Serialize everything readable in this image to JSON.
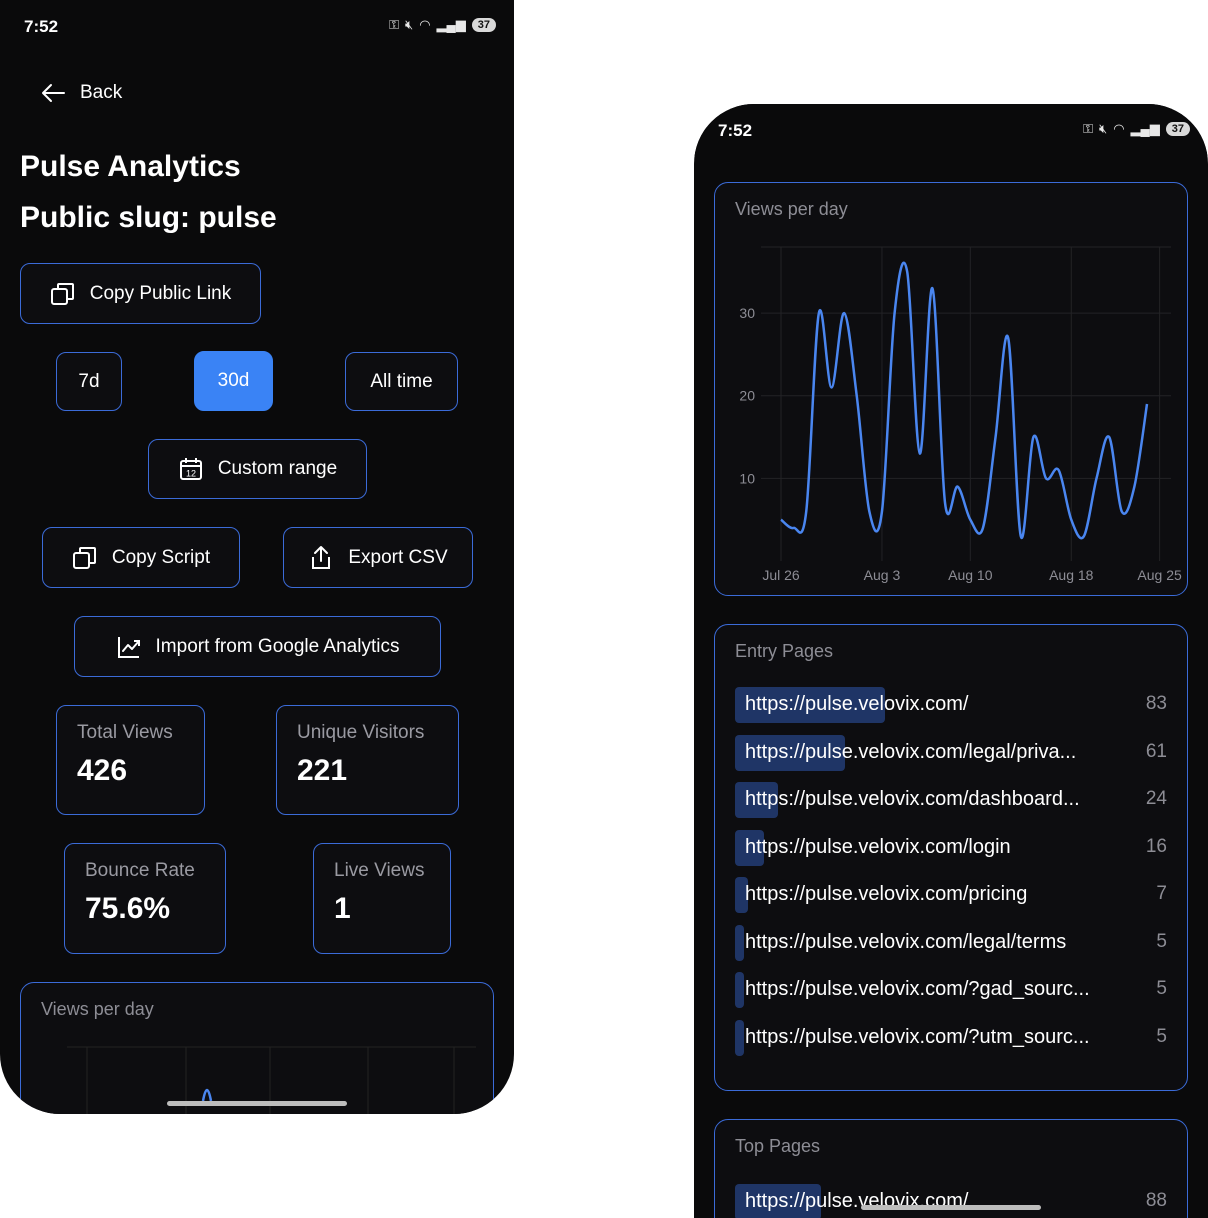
{
  "status": {
    "time": "7:52",
    "battery": "37"
  },
  "screen1": {
    "back_label": "Back",
    "title": "Pulse Analytics",
    "slug": "Public slug: pulse",
    "copy_public_link": "Copy Public Link",
    "ranges": [
      "7d",
      "30d",
      "All time"
    ],
    "active_range": "30d",
    "custom_range": "Custom range",
    "copy_script": "Copy Script",
    "export_csv": "Export CSV",
    "import_ga": "Import from Google Analytics",
    "stats": [
      {
        "label": "Total Views",
        "value": "426"
      },
      {
        "label": "Unique Visitors",
        "value": "221"
      },
      {
        "label": "Bounce Rate",
        "value": "75.6%"
      },
      {
        "label": "Live Views",
        "value": "1"
      }
    ],
    "chart_title": "Views per day"
  },
  "screen2": {
    "chart_title": "Views per day",
    "entry_pages_title": "Entry Pages",
    "entry_pages": [
      {
        "url": "https://pulse.velovix.com/",
        "count": "83"
      },
      {
        "url": "https://pulse.velovix.com/legal/priva...",
        "count": "61"
      },
      {
        "url": "https://pulse.velovix.com/dashboard...",
        "count": "24"
      },
      {
        "url": "https://pulse.velovix.com/login",
        "count": "16"
      },
      {
        "url": "https://pulse.velovix.com/pricing",
        "count": "7"
      },
      {
        "url": "https://pulse.velovix.com/legal/terms",
        "count": "5"
      },
      {
        "url": "https://pulse.velovix.com/?gad_sourc...",
        "count": "5"
      },
      {
        "url": "https://pulse.velovix.com/?utm_sourc...",
        "count": "5"
      }
    ],
    "top_pages_title": "Top Pages",
    "top_pages_first": {
      "url": "https://pulse.velovix.com/",
      "count": "88"
    }
  },
  "chart_data": {
    "type": "line",
    "title": "Views per day",
    "color": "#4a86f0",
    "x": [
      "Jul 26",
      "Jul 27",
      "Jul 28",
      "Jul 29",
      "Jul 30",
      "Jul 31",
      "Aug 1",
      "Aug 2",
      "Aug 3",
      "Aug 4",
      "Aug 5",
      "Aug 6",
      "Aug 7",
      "Aug 8",
      "Aug 9",
      "Aug 10",
      "Aug 11",
      "Aug 12",
      "Aug 13",
      "Aug 14",
      "Aug 15",
      "Aug 16",
      "Aug 17",
      "Aug 18",
      "Aug 19",
      "Aug 20",
      "Aug 21",
      "Aug 22",
      "Aug 23",
      "Aug 24",
      "Aug 25"
    ],
    "values": [
      5,
      4,
      6,
      30,
      21,
      30,
      20,
      6,
      6,
      30,
      35,
      13,
      33,
      7,
      9,
      5,
      4,
      15,
      27,
      3,
      15,
      10,
      11,
      5,
      3,
      10,
      15,
      6,
      9,
      19
    ],
    "xticks": [
      "Jul 26",
      "Aug 3",
      "Aug 10",
      "Aug 18",
      "Aug 25"
    ],
    "yticks": [
      10,
      20,
      30
    ],
    "ylim": [
      0,
      38
    ],
    "grid": true
  }
}
